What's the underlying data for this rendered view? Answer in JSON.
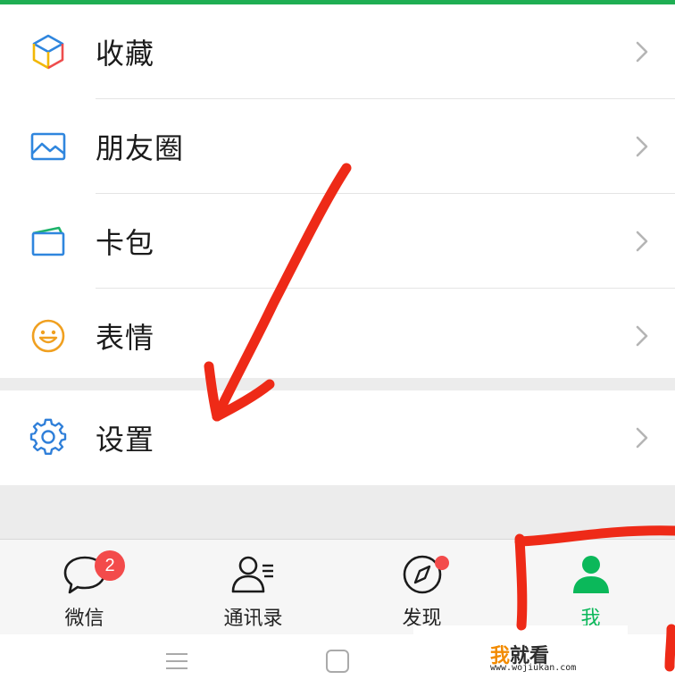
{
  "menu": {
    "items": [
      {
        "label": "收藏",
        "icon": "favorites-cube-icon"
      },
      {
        "label": "朋友圈",
        "icon": "moments-picture-icon"
      },
      {
        "label": "卡包",
        "icon": "card-wallet-icon"
      },
      {
        "label": "表情",
        "icon": "sticker-smiley-icon"
      }
    ],
    "settings": {
      "label": "设置",
      "icon": "gear-icon"
    }
  },
  "tabbar": {
    "tabs": [
      {
        "label": "微信",
        "icon": "chat-bubble-icon",
        "badge": "2"
      },
      {
        "label": "通讯录",
        "icon": "contacts-icon"
      },
      {
        "label": "发现",
        "icon": "compass-icon",
        "has_dot": true
      },
      {
        "label": "我",
        "icon": "person-icon",
        "active": true
      }
    ]
  },
  "watermark": {
    "part1": "我",
    "part2": "就看",
    "url": "www.wojiukan.com"
  },
  "colors": {
    "accent_green": "#0bb85a",
    "badge_red": "#f34b4b",
    "annotation_red": "#ee2a17",
    "settings_blue": "#2f7fd9"
  }
}
